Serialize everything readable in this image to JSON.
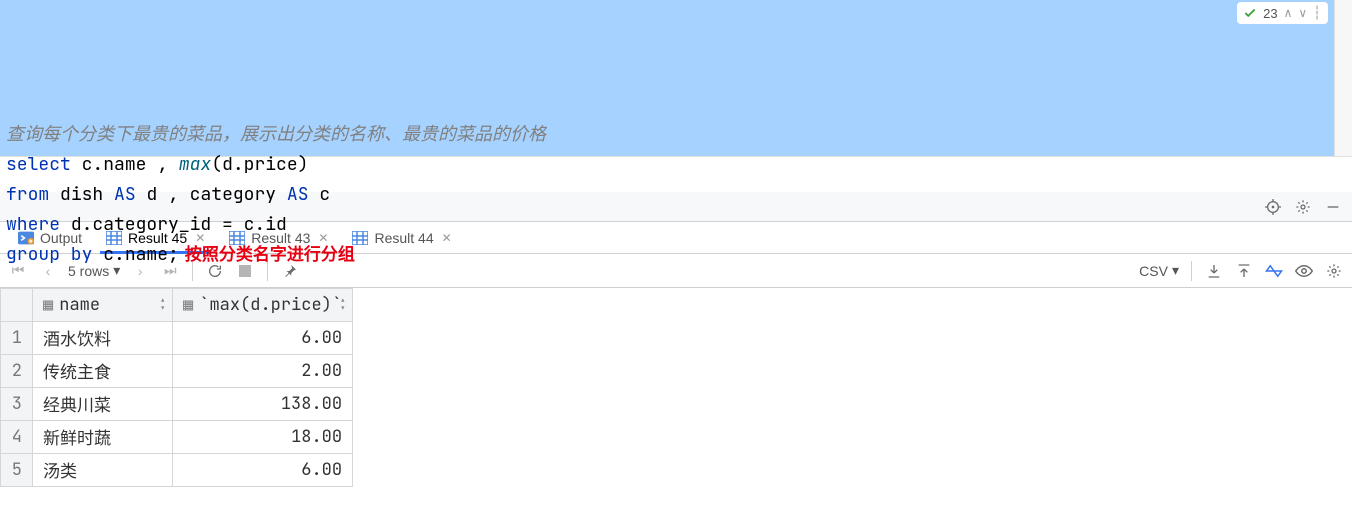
{
  "inspect": {
    "count": "23"
  },
  "sql": {
    "comment": "查询每个分类下最贵的菜品，展示出分类的名称、最贵的菜品的价格",
    "line1": {
      "kw1": "select",
      "id1": "c.name",
      "comma": " , ",
      "fn": "max",
      "arg": "d.price"
    },
    "line2": {
      "kw1": "from",
      "id1": "dish",
      "as1": "AS",
      "al1": "d",
      "comma": " , ",
      "id2": "category",
      "as2": "AS",
      "al2": "c"
    },
    "line3": {
      "kw1": "where",
      "id1": "d.category_id",
      "eq": " = ",
      "id2": "c.id"
    },
    "line4": {
      "kw1": "group by",
      "id1": "c.name",
      "semi": ";"
    },
    "annotation": "按照分类名字进行分组"
  },
  "tabs": [
    {
      "label": "Output",
      "closable": false
    },
    {
      "label": "Result 45",
      "closable": true,
      "active": true
    },
    {
      "label": "Result 43",
      "closable": true
    },
    {
      "label": "Result 44",
      "closable": true
    }
  ],
  "controls": {
    "row_count": "5 rows",
    "export_label": "CSV"
  },
  "table": {
    "columns": [
      "name",
      "`max(d.price)`"
    ],
    "rows": [
      {
        "name": "酒水饮料",
        "price": "6.00"
      },
      {
        "name": "传统主食",
        "price": "2.00"
      },
      {
        "name": "经典川菜",
        "price": "138.00"
      },
      {
        "name": "新鲜时蔬",
        "price": "18.00"
      },
      {
        "name": "汤类",
        "price": "6.00"
      }
    ]
  }
}
